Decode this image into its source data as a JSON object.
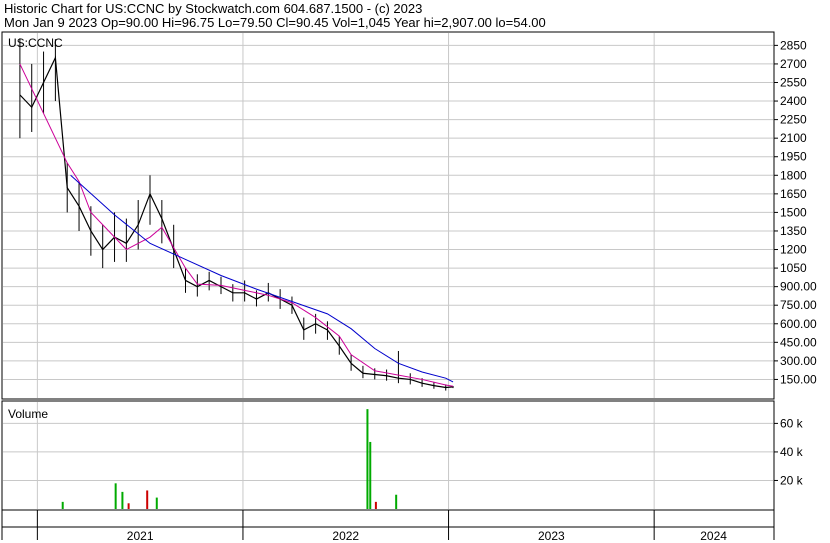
{
  "header": {
    "line1": "Historic Chart for US:CCNC by Stockwatch.com 604.687.1500 - (c) 2023",
    "line2": "Mon Jan  9 2023  Op=90.00  Hi=96.75  Lo=79.50  Cl=90.45  Vol=1,045  Year hi=2,907.00  lo=54.00"
  },
  "chart_data": [
    {
      "type": "line",
      "title": "US:CCNC",
      "ylim": [
        0,
        2950
      ],
      "y_ticks": [
        "2850",
        "2700",
        "2550",
        "2400",
        "2250",
        "2100",
        "1950",
        "1800",
        "1650",
        "1500",
        "1350",
        "1200",
        "1050",
        "900.00",
        "750.00",
        "600.00",
        "450.00",
        "300.00",
        "150.00"
      ],
      "y_tick_values": [
        2850,
        2700,
        2550,
        2400,
        2250,
        2100,
        1950,
        1800,
        1650,
        1500,
        1350,
        1200,
        1050,
        900,
        750,
        600,
        450,
        300,
        150
      ],
      "x_ticks": [
        "2021",
        "2022",
        "2023",
        "2024"
      ],
      "grid": true,
      "price": {
        "x": [
          "2020-12-01",
          "2020-12-22",
          "2021-01-12",
          "2021-02-02",
          "2021-02-23",
          "2021-03-16",
          "2021-04-06",
          "2021-04-27",
          "2021-05-18",
          "2021-06-08",
          "2021-06-29",
          "2021-07-20",
          "2021-08-10",
          "2021-08-31",
          "2021-09-21",
          "2021-10-12",
          "2021-11-02",
          "2021-11-23",
          "2021-12-14",
          "2022-01-04",
          "2022-01-25",
          "2022-02-15",
          "2022-03-08",
          "2022-03-29",
          "2022-04-19",
          "2022-05-10",
          "2022-05-31",
          "2022-06-21",
          "2022-07-12",
          "2022-08-02",
          "2022-08-23",
          "2022-09-13",
          "2022-10-04",
          "2022-10-25",
          "2022-11-15",
          "2022-12-06",
          "2022-12-27",
          "2023-01-09"
        ],
        "close": [
          2450,
          2350,
          2550,
          2750,
          1700,
          1550,
          1350,
          1200,
          1300,
          1250,
          1400,
          1650,
          1450,
          1200,
          950,
          900,
          950,
          900,
          850,
          850,
          800,
          850,
          800,
          750,
          550,
          600,
          550,
          420,
          280,
          200,
          190,
          180,
          160,
          150,
          120,
          100,
          85,
          90
        ],
        "high": [
          2907,
          2700,
          2800,
          2900,
          1900,
          1750,
          1550,
          1400,
          1500,
          1450,
          1600,
          1800,
          1600,
          1400,
          1050,
          1000,
          1020,
          980,
          920,
          950,
          870,
          930,
          880,
          820,
          650,
          680,
          620,
          500,
          350,
          260,
          240,
          230,
          380,
          200,
          160,
          130,
          110,
          97
        ],
        "low": [
          2100,
          2150,
          2300,
          2400,
          1500,
          1350,
          1150,
          1050,
          1100,
          1100,
          1200,
          1400,
          1250,
          1050,
          850,
          820,
          870,
          840,
          780,
          780,
          740,
          780,
          720,
          680,
          470,
          520,
          470,
          350,
          220,
          160,
          150,
          140,
          120,
          110,
          90,
          75,
          60,
          80
        ]
      },
      "ma_short": {
        "x": [
          "2020-12-01",
          "2021-01-12",
          "2021-02-23",
          "2021-03-16",
          "2021-04-06",
          "2021-05-18",
          "2021-06-08",
          "2021-07-20",
          "2021-08-10",
          "2021-09-21",
          "2021-10-12",
          "2021-11-23",
          "2022-01-04",
          "2022-02-15",
          "2022-03-29",
          "2022-05-10",
          "2022-06-21",
          "2022-07-12",
          "2022-08-23",
          "2022-10-04",
          "2022-11-15",
          "2022-12-27",
          "2023-01-09"
        ],
        "values": [
          2700,
          2300,
          1900,
          1750,
          1500,
          1300,
          1200,
          1300,
          1380,
          1050,
          920,
          910,
          870,
          830,
          770,
          650,
          500,
          350,
          220,
          185,
          150,
          105,
          95
        ]
      },
      "ma_long": {
        "x": [
          "2021-03-01",
          "2021-05-18",
          "2021-07-20",
          "2021-09-21",
          "2021-11-23",
          "2022-01-25",
          "2022-03-29",
          "2022-05-31",
          "2022-07-12",
          "2022-08-23",
          "2022-10-04",
          "2022-11-15",
          "2022-12-27",
          "2023-01-09"
        ],
        "values": [
          1800,
          1480,
          1250,
          1120,
          990,
          880,
          780,
          680,
          560,
          400,
          280,
          210,
          160,
          130
        ]
      },
      "colors": {
        "price": "#000000",
        "ma_short": "#cc0099",
        "ma_long": "#0000cc",
        "grid": "#c8c8c8"
      }
    },
    {
      "type": "bar",
      "title": "Volume",
      "ylim": [
        0,
        75000
      ],
      "y_ticks": [
        "60 k",
        "40 k",
        "20 k"
      ],
      "y_tick_values": [
        60000,
        40000,
        20000
      ],
      "bars": {
        "x": [
          "2021-02-15",
          "2021-05-20",
          "2021-06-01",
          "2021-06-12",
          "2021-07-15",
          "2021-08-01",
          "2022-08-10",
          "2022-08-15",
          "2022-08-25",
          "2022-09-30"
        ],
        "values": [
          5000,
          18000,
          12000,
          4000,
          13000,
          8000,
          70000,
          47000,
          5000,
          10000
        ],
        "colors": [
          "#00aa00",
          "#00aa00",
          "#00aa00",
          "#cc0000",
          "#cc0000",
          "#00aa00",
          "#00aa00",
          "#00aa00",
          "#cc0000",
          "#00aa00"
        ]
      }
    }
  ]
}
